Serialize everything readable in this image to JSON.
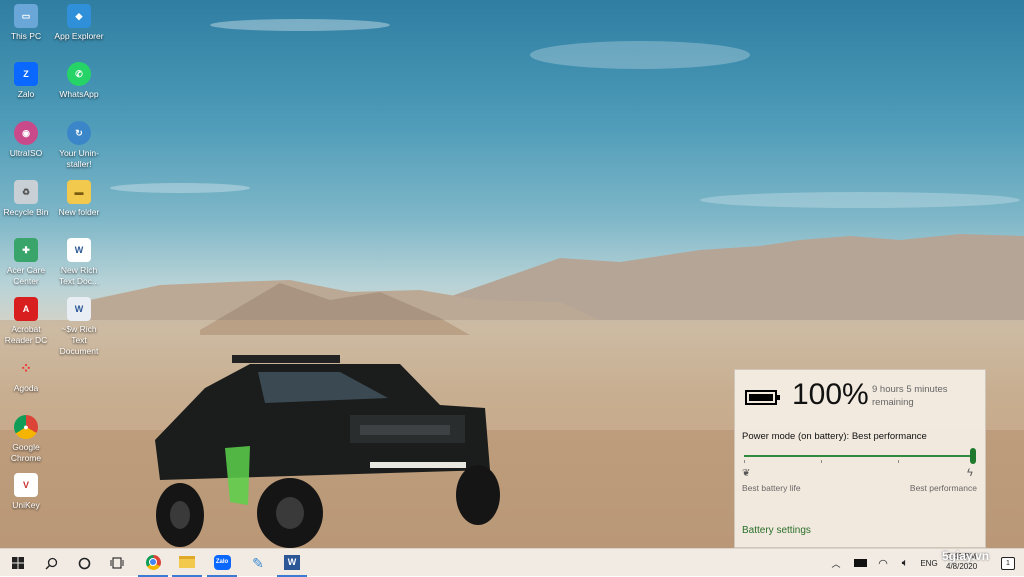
{
  "desktop_icons": [
    {
      "label": "This PC",
      "icon": "pc-icon"
    },
    {
      "label": "App Explorer",
      "icon": "app-explorer-icon"
    },
    {
      "label": "Zalo",
      "icon": "zalo-icon"
    },
    {
      "label": "WhatsApp",
      "icon": "whatsapp-icon"
    },
    {
      "label": "UltraISO",
      "icon": "ultraiso-icon"
    },
    {
      "label": "Your Unin-staller!",
      "icon": "uninstaller-icon"
    },
    {
      "label": "Recycle Bin",
      "icon": "recycle-bin-icon"
    },
    {
      "label": "New folder",
      "icon": "folder-icon"
    },
    {
      "label": "Acer Care Center",
      "icon": "acer-care-icon"
    },
    {
      "label": "New Rich Text Doc...",
      "icon": "word-doc-icon"
    },
    {
      "label": "Acrobat Reader DC",
      "icon": "acrobat-icon"
    },
    {
      "label": "~$w Rich Text Document",
      "icon": "word-doc-icon"
    },
    {
      "label": "Agoda",
      "icon": "agoda-icon"
    },
    {
      "label": "Google Chrome",
      "icon": "chrome-icon"
    },
    {
      "label": "UniKey",
      "icon": "unikey-icon"
    }
  ],
  "battery_flyout": {
    "percent": "100%",
    "time_remaining": "9 hours 5 minutes remaining",
    "power_mode": "Power mode (on battery): Best performance",
    "slider_value": 1.0,
    "left_label": "Best battery life",
    "right_label": "Best performance",
    "settings_link": "Battery settings",
    "accent_color": "#2e8b3e"
  },
  "taskbar": {
    "apps": [
      "start-icon",
      "search-icon",
      "cortana-icon",
      "task-view-icon",
      "chrome-icon",
      "file-explorer-icon",
      "zalo-icon",
      "paint-icon",
      "word-icon"
    ],
    "language": "ENG",
    "time": "3:49 PM",
    "date": "4/8/2020",
    "notification_count": "1"
  },
  "watermark": "5giay.vn"
}
